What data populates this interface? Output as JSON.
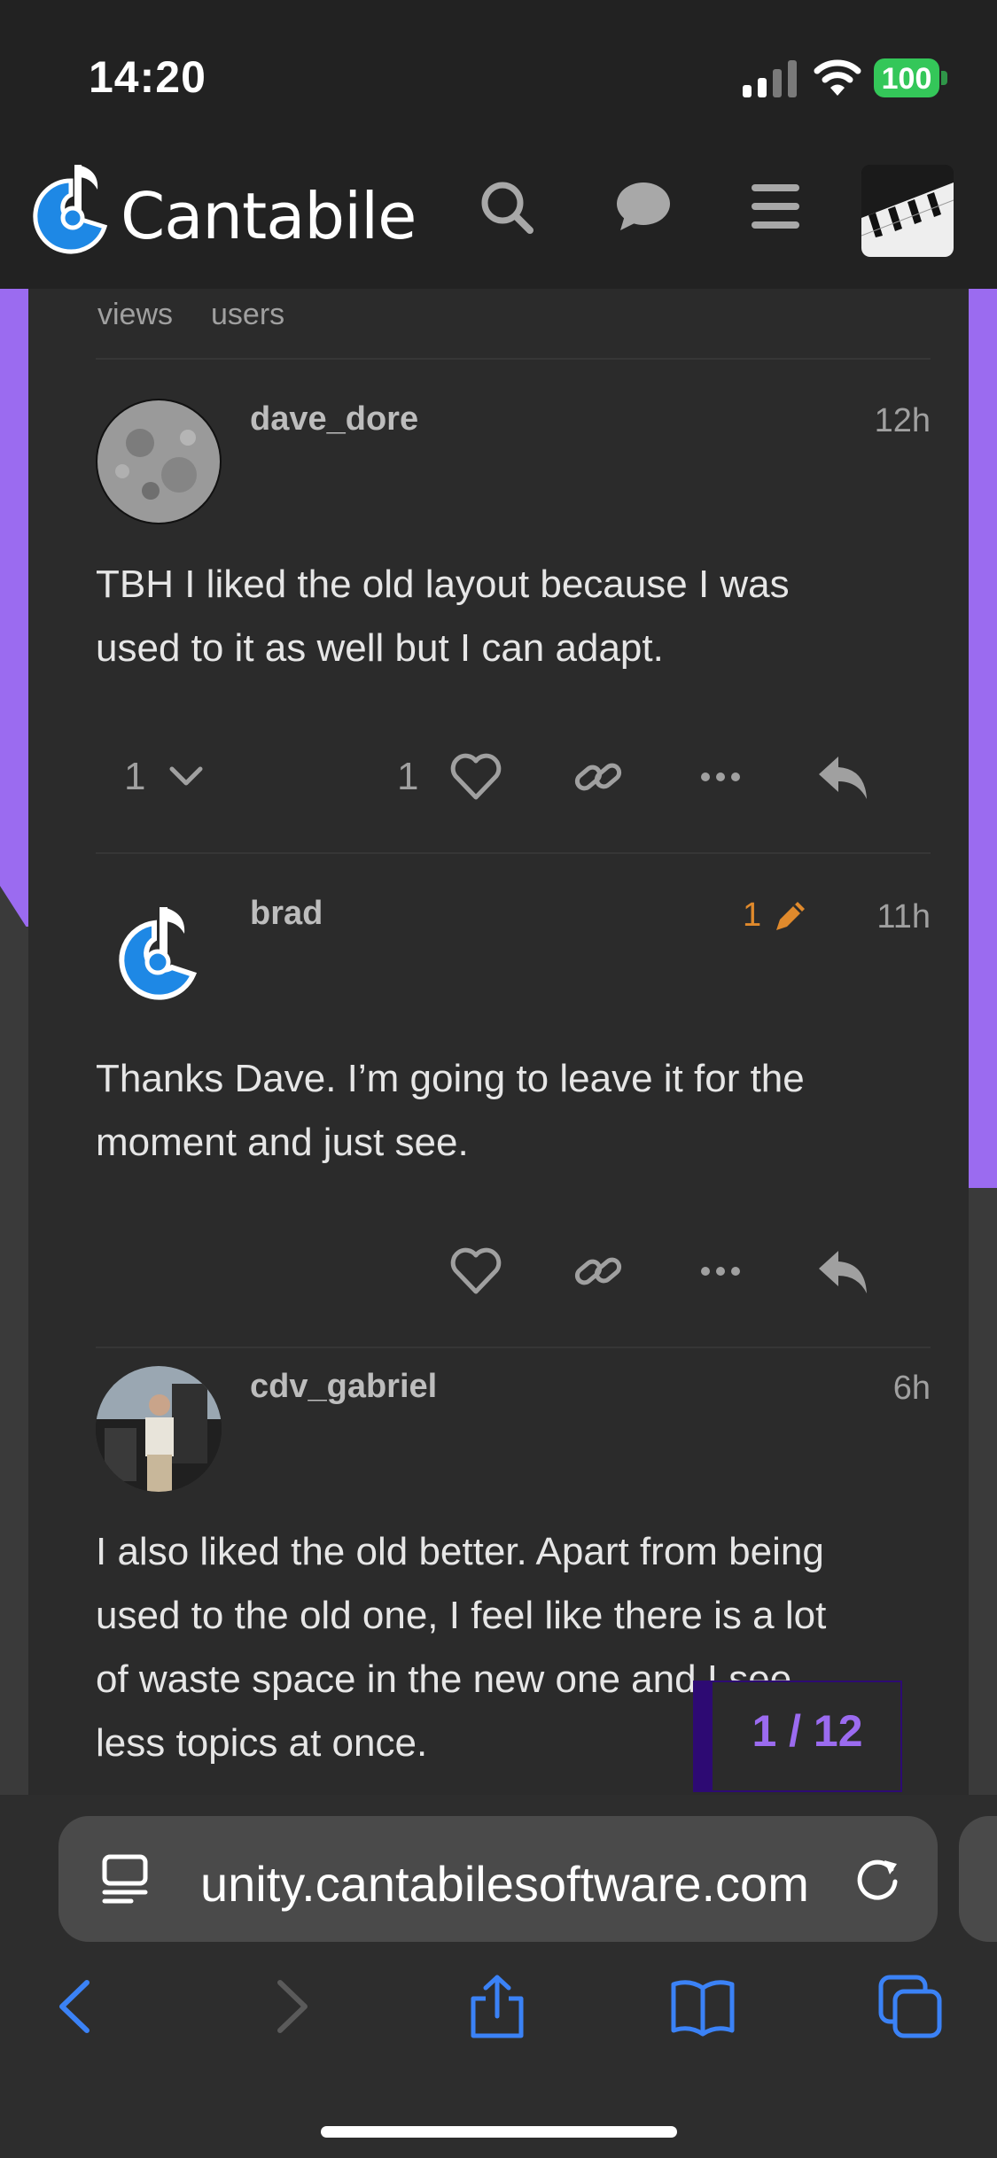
{
  "status_bar": {
    "time": "14:20",
    "battery": "100"
  },
  "header": {
    "logo_text": "Cantabile"
  },
  "topic_stats": {
    "views_label": "views",
    "users_label": "users"
  },
  "posts": [
    {
      "username": "dave_dore",
      "time": "12h",
      "body_line1": "TBH I liked the old layout because I was",
      "body_line2": "used to it as well but I can adapt.",
      "replies_count": "1",
      "likes_count": "1"
    },
    {
      "username": "brad",
      "time": "11h",
      "edits_count": "1",
      "body_line1": "Thanks Dave. I’m going to leave it for the",
      "body_line2": "moment and just see."
    },
    {
      "username": "cdv_gabriel",
      "time": "6h",
      "body_line1": "I also liked the old better. Apart from being",
      "body_line2": "used to the old one, I feel like there is a lot",
      "body_line3": "of waste space in the new one and I see",
      "body_line4": "less topics at once."
    }
  ],
  "progress": {
    "label": "1 / 12"
  },
  "browser": {
    "url": "unity.cantabilesoftware.com"
  },
  "colors": {
    "accent": "#9b6bf0",
    "brand_blue": "#1e88e5",
    "edit_orange": "#e08a2c",
    "battery_green": "#34c759"
  },
  "icons": [
    "search-icon",
    "chat-icon",
    "hamburger-icon",
    "heart-icon",
    "link-icon",
    "more-icon",
    "reply-icon",
    "pencil-icon",
    "chevron-down-icon",
    "reader-icon",
    "reload-icon",
    "back-icon",
    "forward-icon",
    "share-icon",
    "bookmarks-icon",
    "tabs-icon"
  ]
}
